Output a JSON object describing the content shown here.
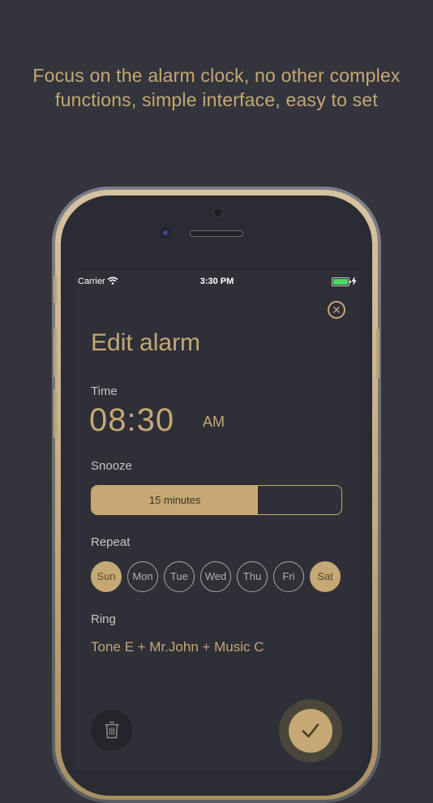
{
  "headline": "Focus on the alarm clock, no other complex functions, simple interface, easy to set",
  "status_bar": {
    "carrier": "Carrier",
    "time": "3:30 PM"
  },
  "screen": {
    "title": "Edit alarm",
    "time_section": {
      "label": "Time",
      "value": "08:30",
      "period": "AM"
    },
    "snooze": {
      "label": "Snooze",
      "selected": "15 minutes",
      "fill_fraction": 0.667
    },
    "repeat": {
      "label": "Repeat",
      "days": [
        {
          "name": "Sun",
          "active": true
        },
        {
          "name": "Mon",
          "active": false
        },
        {
          "name": "Tue",
          "active": false
        },
        {
          "name": "Wed",
          "active": false
        },
        {
          "name": "Thu",
          "active": false
        },
        {
          "name": "Fri",
          "active": false
        },
        {
          "name": "Sat",
          "active": true
        }
      ]
    },
    "ring": {
      "label": "Ring",
      "value": "Tone E + Mr.John + Music C"
    }
  },
  "icons": {
    "close": "close-icon",
    "delete": "trash-icon",
    "confirm": "check-icon"
  },
  "colors": {
    "accent_gold": "#c5a874",
    "background": "#33343c",
    "screen_bg": "#2e2f37"
  }
}
